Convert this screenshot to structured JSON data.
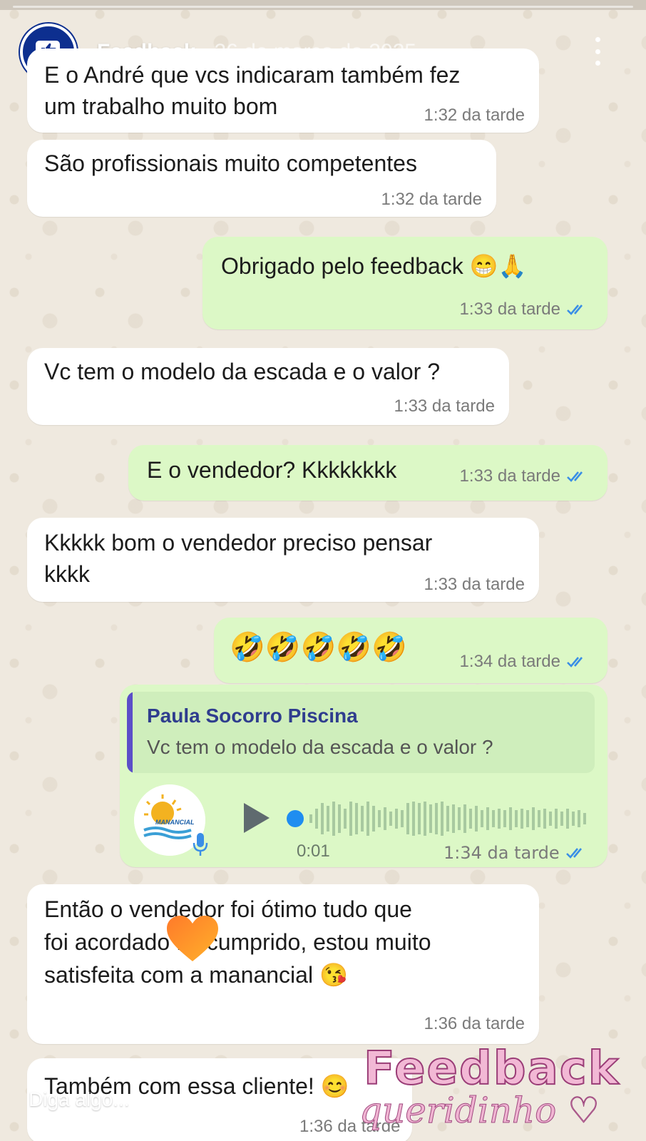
{
  "story": {
    "title": "Feedback",
    "date": "26 de março de 2025",
    "reply_placeholder": "Diga algo...",
    "avatar_icon": "thumbs-up-chat-icon"
  },
  "messages": [
    {
      "direction": "in",
      "lines": [
        "E o André que vcs indicaram também fez",
        "um trabalho muito bom"
      ],
      "time": "1:32 da tarde"
    },
    {
      "direction": "in",
      "lines": [
        "São profissionais muito competentes"
      ],
      "time": "1:32 da tarde"
    },
    {
      "direction": "out",
      "lines": [
        "Obrigado pelo feedback 😁🙏"
      ],
      "time": "1:33 da tarde"
    },
    {
      "direction": "in",
      "lines": [
        "Vc tem o modelo da escada e o valor ?"
      ],
      "time": "1:33 da tarde"
    },
    {
      "direction": "out",
      "lines": [
        "E o vendedor? Kkkkkkkk"
      ],
      "time": "1:33 da tarde"
    },
    {
      "direction": "in",
      "lines": [
        "Kkkkk bom o vendedor preciso pensar",
        "kkkk"
      ],
      "time": "1:33 da tarde"
    },
    {
      "direction": "out",
      "lines": [
        "🤣🤣🤣🤣🤣"
      ],
      "time": "1:34 da tarde"
    },
    {
      "direction": "in",
      "lines": [
        "Então o vendedor foi ótimo tudo que",
        "foi acordado foi cumprido, estou muito",
        "satisfeita com a manancial 😘"
      ],
      "time": "1:36 da tarde"
    },
    {
      "direction": "in",
      "lines": [
        "Também com essa cliente! 😊"
      ],
      "time": "1:36 da tarde"
    }
  ],
  "voice_message": {
    "quoted_sender": "Paula Socorro Piscina",
    "quoted_text": "Vc tem o modelo da escada e o valor ?",
    "duration": "0:01",
    "time": "1:34 da tarde",
    "avatar_label": "MANANCIAL"
  },
  "sticker": {
    "title": "Feedback",
    "subtitle": "queridinho ♡"
  },
  "colors": {
    "incoming": "#ffffff",
    "outgoing": "#dcf8c6",
    "read_ticks": "#3a8ee6",
    "avatar_bg": "#0d2f8f"
  }
}
